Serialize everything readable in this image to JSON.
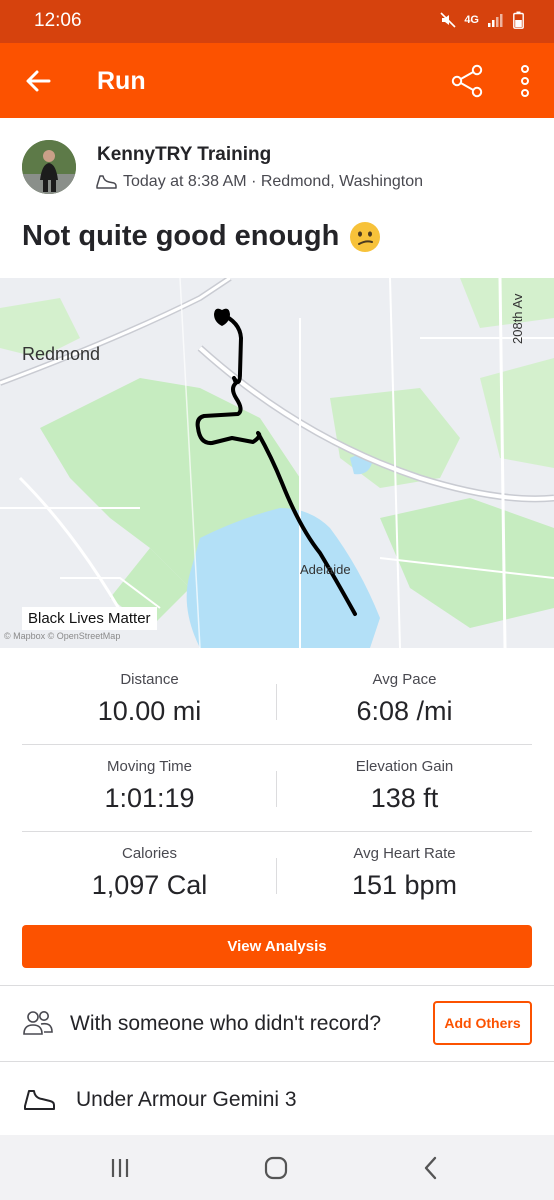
{
  "status": {
    "time": "12:06",
    "network": "4G"
  },
  "app_bar": {
    "title": "Run"
  },
  "athlete": {
    "name": "KennyTRY Training",
    "meta": "Today at 8:38 AM · Redmond, Washington"
  },
  "activity": {
    "title": "Not quite good enough",
    "emoji": "😕"
  },
  "map": {
    "labels": {
      "city": "Redmond",
      "area": "Adelaide",
      "road": "208th Av"
    },
    "badge": "Black Lives Matter",
    "attribution": "© Mapbox © OpenStreetMap"
  },
  "stats": [
    {
      "label": "Distance",
      "value": "10.00 mi"
    },
    {
      "label": "Avg Pace",
      "value": "6:08 /mi"
    },
    {
      "label": "Moving Time",
      "value": "1:01:19"
    },
    {
      "label": "Elevation Gain",
      "value": "138 ft"
    },
    {
      "label": "Calories",
      "value": "1,097 Cal"
    },
    {
      "label": "Avg Heart Rate",
      "value": "151 bpm"
    }
  ],
  "buttons": {
    "view_analysis": "View Analysis",
    "add_others": "Add Others"
  },
  "with_others": {
    "text": "With someone who didn't record?"
  },
  "gear": {
    "text": "Under Armour Gemini 3"
  },
  "colors": {
    "brand": "#fc5200",
    "status_bar": "#d6420d",
    "water": "#b3e0f7",
    "park": "#c6ecc0"
  }
}
